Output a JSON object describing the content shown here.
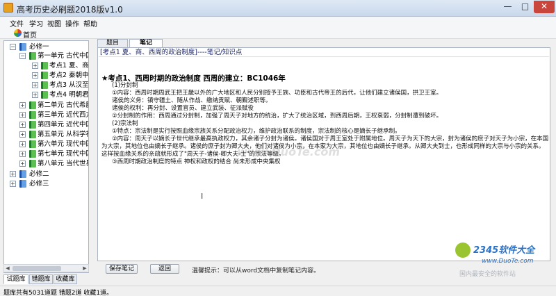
{
  "window": {
    "title": "高考历史必刷题2018版v1.0",
    "minimize_glyph": "—",
    "maximize_glyph": "□",
    "close_glyph": "✕"
  },
  "menu": [
    "文件",
    "学习",
    "视图",
    "操作",
    "帮助"
  ],
  "toolbar": {
    "home_label": "首页"
  },
  "tree": [
    {
      "label": "必修一",
      "expander": "−",
      "icon": "book-icon",
      "color": "blue"
    },
    {
      "label": "第一单元 古代中国",
      "expander": "−",
      "icon": "book-icon",
      "color": "green"
    },
    {
      "label": "考点1 夏、商",
      "expander": "+",
      "icon": "book-icon",
      "color": "green"
    },
    {
      "label": "考点2 秦朝中",
      "expander": "+",
      "icon": "book-icon",
      "color": "green"
    },
    {
      "label": "考点3 从汉至",
      "expander": "+",
      "icon": "book-icon",
      "color": "green"
    },
    {
      "label": "考点4 明朝君",
      "expander": "+",
      "icon": "book-icon",
      "color": "green"
    },
    {
      "label": "第二单元 古代希腊",
      "expander": "+",
      "icon": "book-icon",
      "color": "green"
    },
    {
      "label": "第三单元 近代西方",
      "expander": "+",
      "icon": "book-icon",
      "color": "green"
    },
    {
      "label": "第四单元 近代中国",
      "expander": "+",
      "icon": "book-icon",
      "color": "green"
    },
    {
      "label": "第五单元 从科学社",
      "expander": "+",
      "icon": "book-icon",
      "color": "green"
    },
    {
      "label": "第六单元 现代中国",
      "expander": "+",
      "icon": "book-icon",
      "color": "green"
    },
    {
      "label": "第七单元 现代中国",
      "expander": "+",
      "icon": "book-icon",
      "color": "green"
    },
    {
      "label": "第八单元 当代世界",
      "expander": "+",
      "icon": "book-icon",
      "color": "green"
    },
    {
      "label": "必修二",
      "expander": "+",
      "icon": "book-icon",
      "color": "blue"
    },
    {
      "label": "必修三",
      "expander": "+",
      "icon": "book-icon",
      "color": "blue"
    }
  ],
  "bottom_tabs": [
    "试题库",
    "错题库",
    "收藏库"
  ],
  "content_tabs": [
    "题目",
    "笔记"
  ],
  "breadcrumb": "[考点1 夏、商、西周的政治制度]----笔记/知识点",
  "note": {
    "title": "★考点1、西周时期的政治制度 西周的建立：BC1046年",
    "lines": [
      "(1)分封制",
      "①内容：西周时期周武王把王畿以外的广大地区和人民分别授予王族、功臣和古代帝王的后代，让他们建立诸侯国，拱卫王室。",
      "诸侯的义务：镇守疆土、随从作战、缴纳贡赋、朝觐述职等。",
      "诸侯的权利：再分封、设置官员、建立武装、征派赋役",
      "②分封制的作用：西周通过分封制，加强了周天子对地方的统治，扩大了统治区域，到西周后期，王权衰弱，分封制遭到破坏。",
      "(2)宗法制",
      "①特点：宗法制是实行按照血缘宗族关系分配政治权力，维护政治联系的制度，宗法制的核心是嫡长子继承制。",
      "②内容：周天子以嫡长子世代继承最高执政权力，其余诸子分封为诸侯。诸侯国对于周王室处于附属地位。周天子为天下的大宗，封为诸侯的庶子对天子为小宗，在本国",
      "为大宗，其地位也由嫡长子继承。诸侯的庶子封为卿大夫，他们对诸侯为小宗，在本家为大宗，其地位也由嫡长子继承。从卿大夫到士，也形成同样的大宗与小宗的关系。",
      "这样按血缘关系的亲疏就形成了\"周天子-诸侯-卿大夫-士\"的宗法等级。",
      "③西周时期政治制度的特点 神权和政权的结合 尚未形成中央集权"
    ]
  },
  "watermark": "www.DuoTe.com",
  "buttons": {
    "save": "保存笔记",
    "back": "返回"
  },
  "tip": "温馨提示：可以从word文档中复制笔记内容。",
  "status": "题库共有5031道题   错题2道   收藏1道。",
  "branding": {
    "name": "2345软件大全",
    "url": "www.DuoTe.com",
    "slogan": "国内最安全的软件站"
  }
}
